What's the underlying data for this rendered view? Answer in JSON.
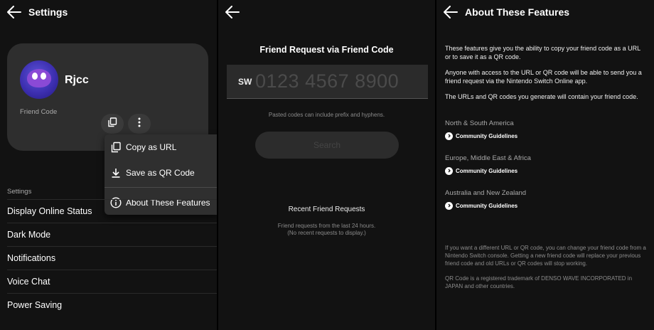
{
  "screen1": {
    "title": "Settings",
    "username": "Rjcc",
    "friend_code_label": "Friend Code",
    "menu": {
      "copy_as_url": "Copy as URL",
      "save_as_qr": "Save as QR Code",
      "about": "About These Features"
    },
    "section_label": "Settings",
    "items": [
      "Display Online Status",
      "Dark Mode",
      "Notifications",
      "Voice Chat",
      "Power Saving"
    ]
  },
  "screen2": {
    "title": "Friend Request via Friend Code",
    "code_prefix": "SW",
    "code_placeholder": "0123 4567 8900",
    "hint": "Pasted codes can include prefix and hyphens.",
    "search_label": "Search",
    "recent_title": "Recent Friend Requests",
    "recent_sub_1": "Friend requests from the last 24 hours.",
    "recent_sub_2": "(No recent requests to display.)"
  },
  "screen3": {
    "title": "About These Features",
    "para1": "These features give you the ability to copy your friend code as a URL or to save it as a QR code.",
    "para2": "Anyone with access to the URL or QR code will be able to send you a friend request via the Nintendo Switch Online app.",
    "para3": "The URLs and QR codes you generate will contain your friend code.",
    "regions": [
      {
        "name": "North & South America",
        "link": "Community Guidelines"
      },
      {
        "name": "Europe, Middle East & Africa",
        "link": "Community Guidelines"
      },
      {
        "name": "Australia and New Zealand",
        "link": "Community Guidelines"
      }
    ],
    "footnote1": "If you want a different URL or QR code, you can change your friend code from a Nintendo Switch console. Getting a new friend code will replace your previous friend code and old URLs or QR codes will stop working.",
    "footnote2": "QR Code is a registered trademark of DENSO WAVE INCORPORATED in JAPAN and other countries."
  },
  "colors": {
    "background": "#121212",
    "card": "#2e2e2e",
    "menu": "#2f2f2f",
    "muted_text": "#aaaaaa"
  }
}
